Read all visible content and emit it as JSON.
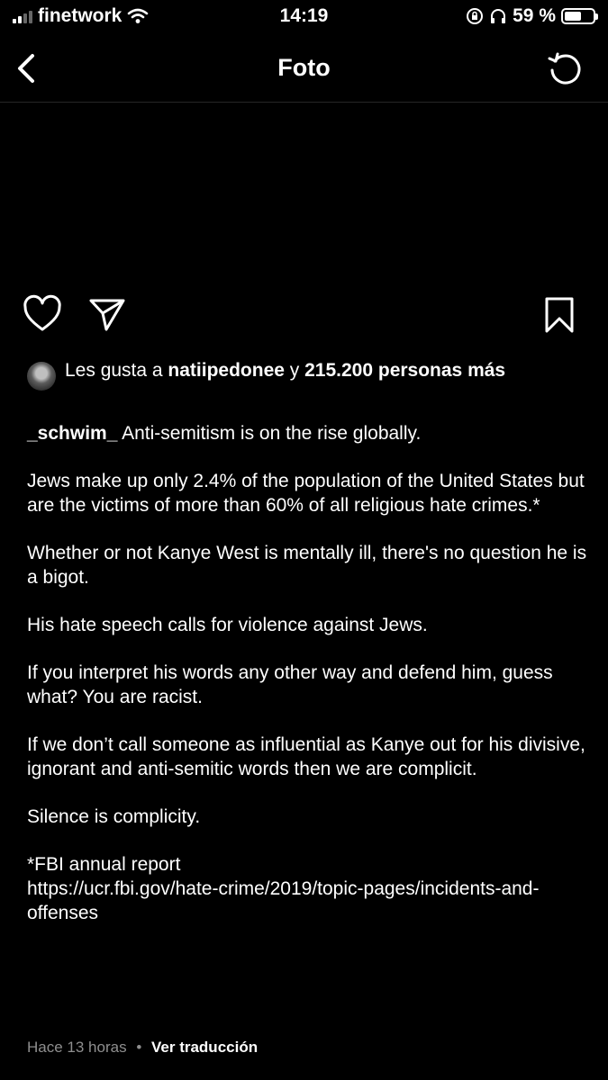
{
  "status_bar": {
    "carrier": "finetwork",
    "time": "14:19",
    "battery": "59 %",
    "battery_level": 0.59
  },
  "nav": {
    "title": "Foto"
  },
  "likes": {
    "prefix": "Les gusta a ",
    "user": "natiipedonee",
    "connector": " y ",
    "count": "215.200 personas",
    "suffix": " más"
  },
  "caption": {
    "username": "_schwim_",
    "first_line": " Anti-semitism is on the rise globally.",
    "paragraphs": [
      "Jews make up only 2.4% of the population of the United States but are the victims of more than 60% of all religious hate crimes.*",
      "Whether or not Kanye West is mentally ill, there's no question he is a bigot.",
      "His hate speech calls for violence against Jews.",
      "If you interpret his words any other way and defend him, guess what? You are racist.",
      "If we don’t call someone as influential as Kanye out for his divisive, ignorant and anti-semitic words then we are complicit.",
      "Silence is complicity."
    ],
    "footnote_label": "*FBI annual report",
    "footnote_link": "https://ucr.fbi.gov/hate-crime/2019/topic-pages/incidents-and-offenses"
  },
  "footer": {
    "time_ago": "Hace 13 horas",
    "separator": "•",
    "translate": "Ver traducción"
  },
  "icons": {
    "signal": "signal-bars-icon",
    "wifi": "wifi-icon",
    "lock": "orientation-lock-icon",
    "headphones": "headphones-icon",
    "battery": "battery-icon",
    "back": "chevron-left-icon",
    "refresh": "refresh-icon",
    "like": "heart-icon",
    "share": "paper-plane-icon",
    "save": "bookmark-icon"
  }
}
